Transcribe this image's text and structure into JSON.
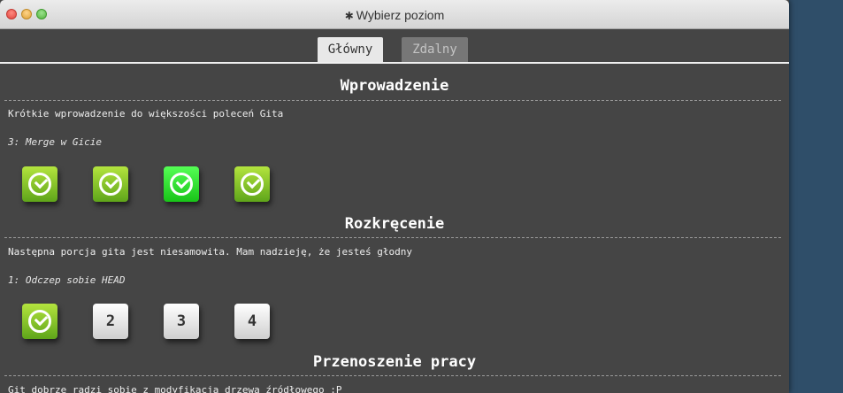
{
  "window": {
    "title_icon": "gear-icon",
    "title": "Wybierz poziom"
  },
  "tabs": [
    {
      "label": "Główny",
      "active": true
    },
    {
      "label": "Zdalny",
      "active": false
    }
  ],
  "sections": [
    {
      "title": "Wprowadzenie",
      "description": "Krótkie wprowadzenie do większości poleceń Gita",
      "selected_level": "3: Merge w Gicie",
      "levels": [
        {
          "state": "done",
          "icon": "checkmark-icon"
        },
        {
          "state": "done",
          "icon": "checkmark-icon"
        },
        {
          "state": "current",
          "icon": "checkmark-icon"
        },
        {
          "state": "done",
          "icon": "checkmark-icon"
        }
      ]
    },
    {
      "title": "Rozkręcenie",
      "description": "Następna porcja gita jest niesamowita. Mam nadzieję, że jesteś głodny",
      "selected_level": "1: Odczep sobie HEAD",
      "levels": [
        {
          "state": "done",
          "icon": "checkmark-icon"
        },
        {
          "state": "todo",
          "label": "2"
        },
        {
          "state": "todo",
          "label": "3"
        },
        {
          "state": "todo",
          "label": "4"
        }
      ]
    },
    {
      "title": "Przenoszenie pracy",
      "description": "Git dobrze radzi sobie z modyfikacją drzewa źródłowego :P"
    }
  ],
  "colors": {
    "panel_bg": "#454545",
    "desktop_bg": "#2f4e69",
    "done": "#8cc92a",
    "current": "#2ee82e"
  }
}
